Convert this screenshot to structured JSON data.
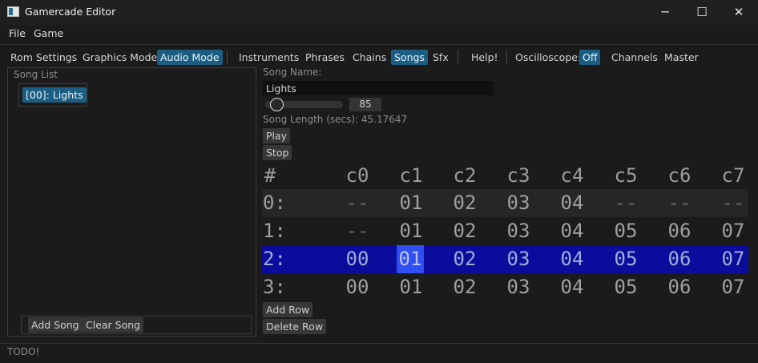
{
  "window": {
    "title": "Gamercade Editor",
    "minimize": "─",
    "maximize": "☐",
    "close": "✕"
  },
  "menu": [
    {
      "label": "File"
    },
    {
      "label": "Game"
    }
  ],
  "modes": [
    {
      "label": "Rom Settings",
      "active": false
    },
    {
      "label": "Graphics Mode",
      "active": false
    },
    {
      "label": "Audio Mode",
      "active": true
    }
  ],
  "audio_tabs": [
    {
      "label": "Instruments",
      "active": false
    },
    {
      "label": "Phrases",
      "active": false
    },
    {
      "label": "Chains",
      "active": false
    },
    {
      "label": "Songs",
      "active": true
    },
    {
      "label": "Sfx",
      "active": false
    }
  ],
  "help_label": "Help!",
  "oscilloscope": {
    "label": "Oscilloscope:",
    "value": "Off"
  },
  "extra_tabs": [
    {
      "label": "Channels"
    },
    {
      "label": "Master"
    }
  ],
  "song_list": {
    "label": "Song List",
    "items": [
      {
        "label": "[00]: Lights",
        "selected": true
      }
    ],
    "add_song": "Add Song",
    "clear_song": "Clear Song"
  },
  "song": {
    "name_label": "Song Name:",
    "name_value": "Lights",
    "bpm_value": "85",
    "bpm_fraction": 0.05,
    "length_text": "Song Length (secs): 45.17647",
    "play": "Play",
    "stop": "Stop"
  },
  "grid": {
    "headers": [
      "#",
      "c0",
      "c1",
      "c2",
      "c3",
      "c4",
      "c5",
      "c6",
      "c7"
    ],
    "rows": [
      {
        "label": "0:",
        "cells": [
          "--",
          "01",
          "02",
          "03",
          "04",
          "--",
          "--",
          "--"
        ]
      },
      {
        "label": "1:",
        "cells": [
          "--",
          "01",
          "02",
          "03",
          "04",
          "05",
          "06",
          "07"
        ]
      },
      {
        "label": "2:",
        "cells": [
          "00",
          "01",
          "02",
          "03",
          "04",
          "05",
          "06",
          "07"
        ]
      },
      {
        "label": "3:",
        "cells": [
          "00",
          "01",
          "02",
          "03",
          "04",
          "05",
          "06",
          "07"
        ]
      }
    ],
    "selected_row": 2,
    "selected_col": 1,
    "add_row": "Add Row",
    "delete_row": "Delete Row"
  },
  "status": "TODO!",
  "colors": {
    "accent": "#1c5e82",
    "selected_row": "#0b0b9c",
    "selected_cell": "#2f4ff0",
    "alt_row": "#262626"
  }
}
